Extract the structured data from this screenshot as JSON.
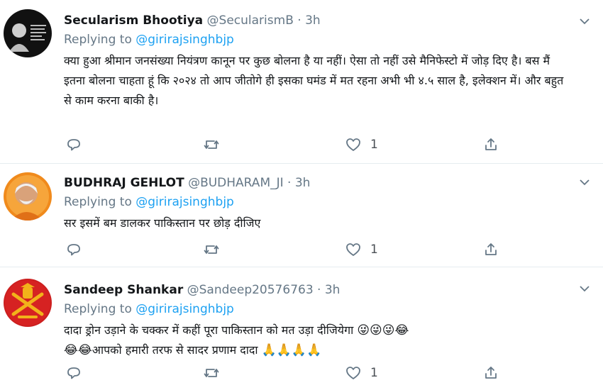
{
  "tweets": [
    {
      "name": "Secularism Bhootiya",
      "handle": "@SecularismB",
      "time": "3h",
      "reply_prefix": "Replying to ",
      "reply_to": "@girirajsinghbjp",
      "text": "क्या हुआ श्रीमान जनसंख्या नियंत्रण कानून पर कुछ बोलना है या नहीं। ऐसा तो नहीं उसे मैनिफेस्टो में जोड़ दिए है। बस मैं इतना बोलना चाहता हूं कि २०२४ तो आप जीतोगे ही इसका घमंड में मत रहना अभी भी ४.५ साल है, इलेक्शन में। और बहुत से काम करना बाकी है।",
      "replies": "",
      "retweets": "",
      "likes": "1"
    },
    {
      "name": "BUDHRAJ GEHLOT",
      "handle": "@BUDHARAM_JI",
      "time": "3h",
      "reply_prefix": "Replying to ",
      "reply_to": "@girirajsinghbjp",
      "text": "सर इसमें बम डालकर पाकिस्तान पर छोड़ दीजिए",
      "replies": "",
      "retweets": "",
      "likes": "1"
    },
    {
      "name": "Sandeep Shankar",
      "handle": "@Sandeep20576763",
      "time": "3h",
      "reply_prefix": "Replying to ",
      "reply_to": "@girirajsinghbjp",
      "text_line1": "दादा ड्रोन उड़ाने के चक्कर में कहीं पूरा पाकिस्तान को मत उड़ा दीजियेगा ",
      "emoji_line1": "😜😜😜😂",
      "emoji_line2_pre": "😂😂",
      "text_line2": "आपको हमारी तरफ से सादर प्रणाम दादा ",
      "emoji_line2_post": "🙏🙏🙏🙏",
      "replies": "",
      "retweets": "",
      "likes": "1"
    }
  ],
  "icons": {
    "reply": "reply-icon",
    "retweet": "retweet-icon",
    "like": "heart-icon",
    "share": "share-icon",
    "more": "chevron-down-icon"
  },
  "colors": {
    "link": "#1da1f2",
    "muted": "#657786",
    "text": "#14171a"
  }
}
